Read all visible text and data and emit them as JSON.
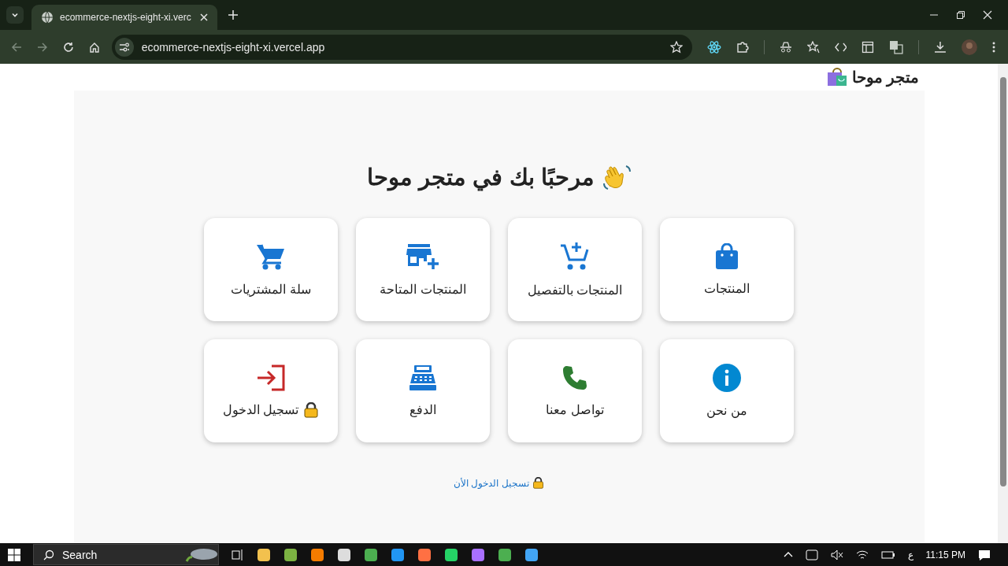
{
  "browser": {
    "tab_title": "ecommerce-nextjs-eight-xi.verc",
    "url": "ecommerce-nextjs-eight-xi.vercel.app"
  },
  "header": {
    "store_name": "متجر موحا"
  },
  "welcome": "مرحبًا بك في متجر موحا",
  "cards": [
    {
      "kind": "bag",
      "label": "المنتجات"
    },
    {
      "kind": "cart-add",
      "label": "المنتجات بالتفصيل"
    },
    {
      "kind": "store-add",
      "label": "المنتجات المتاحة"
    },
    {
      "kind": "cart",
      "label": "سلة المشتريات"
    },
    {
      "kind": "info",
      "label": "من نحن"
    },
    {
      "kind": "phone",
      "label": "تواصل معنا"
    },
    {
      "kind": "register",
      "label": "الدفع"
    },
    {
      "kind": "login",
      "label": "تسجيل الدخول",
      "lock": true
    }
  ],
  "login_link": "تسجيل الدخول الأن",
  "taskbar": {
    "search": "Search",
    "language": "ع",
    "time": "11:15 PM"
  }
}
